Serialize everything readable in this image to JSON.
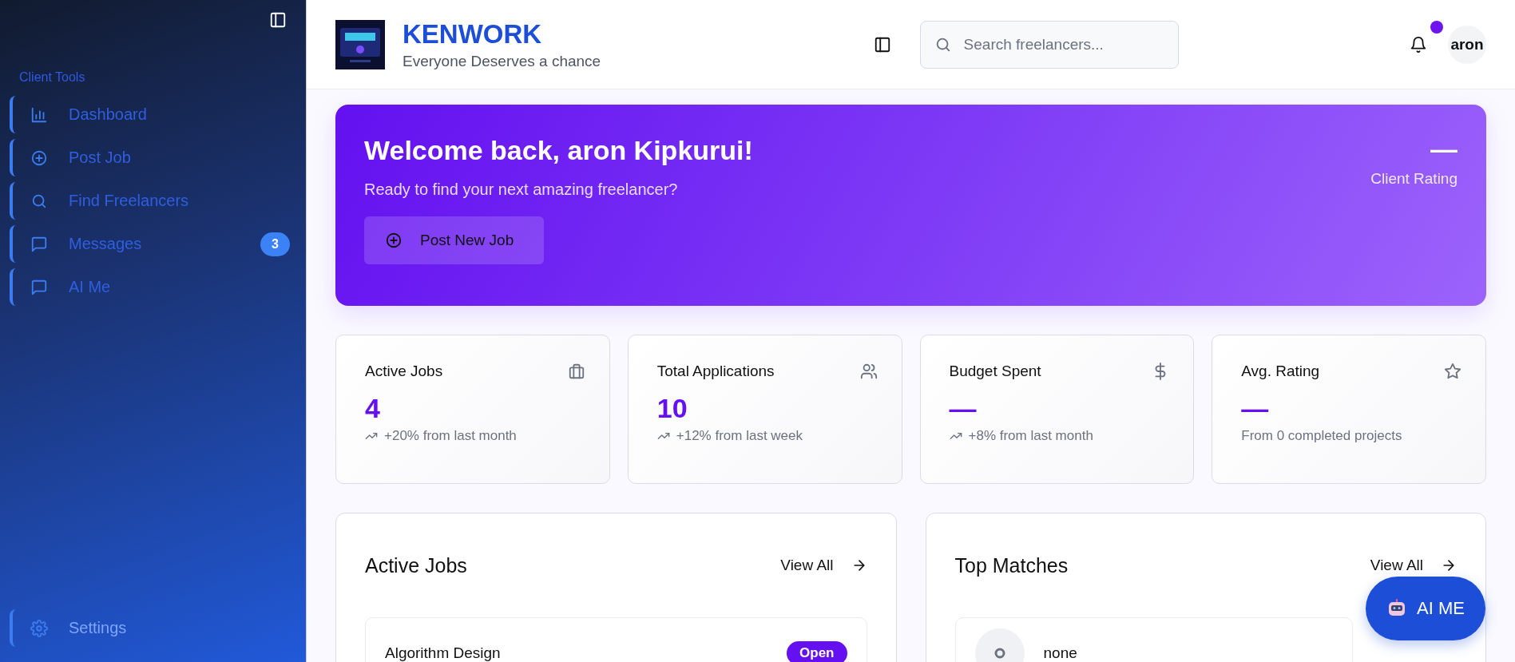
{
  "sidebar": {
    "section_title": "Client Tools",
    "items": [
      {
        "label": "Dashboard"
      },
      {
        "label": "Post Job"
      },
      {
        "label": "Find Freelancers"
      },
      {
        "label": "Messages",
        "badge": "3"
      },
      {
        "label": "AI Me"
      }
    ],
    "footer_item": {
      "label": "Settings"
    }
  },
  "header": {
    "brand": "KENWORK",
    "tagline": "Everyone Deserves a chance",
    "search": {
      "placeholder": "Search freelancers..."
    },
    "notification_dot": true,
    "user": "aron"
  },
  "banner": {
    "title": "Welcome back, aron Kipkurui!",
    "subtitle": "Ready to find your next amazing freelancer?",
    "button": "Post New Job",
    "rating_value": "—",
    "rating_label": "Client Rating"
  },
  "stats": [
    {
      "title": "Active Jobs",
      "value": "4",
      "note": "+20% from last month",
      "trend": true
    },
    {
      "title": "Total Applications",
      "value": "10",
      "note": "+12% from last week",
      "trend": true
    },
    {
      "title": "Budget Spent",
      "value": "—",
      "note": "+8% from last month",
      "trend": true
    },
    {
      "title": "Avg. Rating",
      "value": "—",
      "note": "From 0 completed projects",
      "trend": false
    }
  ],
  "panels": [
    {
      "title": "Active Jobs",
      "link": "View All",
      "kind": "job",
      "item_title": "Algorithm Design",
      "item_status": "Open"
    },
    {
      "title": "Top Matches",
      "link": "View All",
      "kind": "match",
      "item_title": "none"
    }
  ],
  "fab": {
    "label": "AI ME"
  }
}
